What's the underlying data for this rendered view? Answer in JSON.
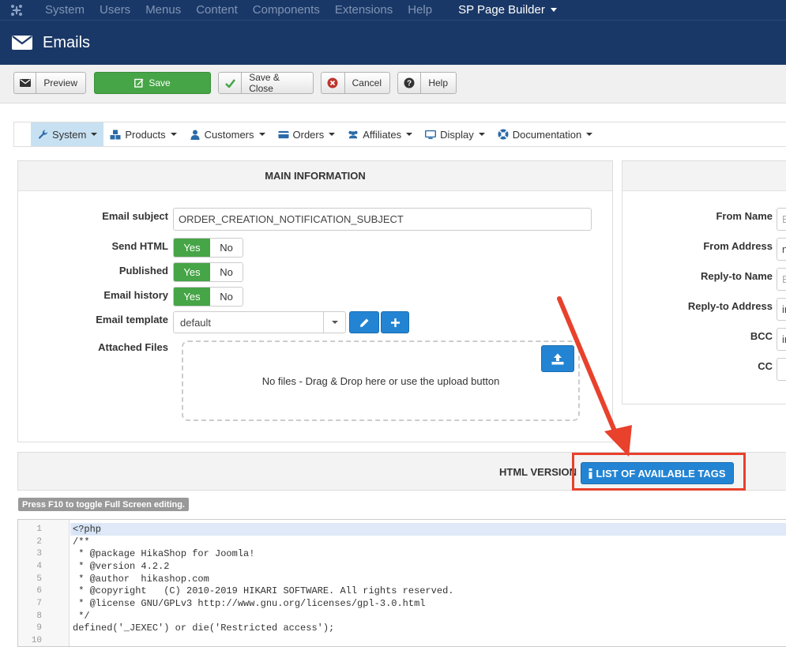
{
  "topnav": {
    "items": [
      "System",
      "Users",
      "Menus",
      "Content",
      "Components",
      "Extensions",
      "Help"
    ],
    "sp_label": "SP Page Builder"
  },
  "header": {
    "title": "Emails"
  },
  "toolbar": {
    "preview": "Preview",
    "save": "Save",
    "save_close": "Save & Close",
    "cancel": "Cancel",
    "help": "Help"
  },
  "menubar": {
    "items": [
      {
        "label": "System",
        "icon": "wrench-icon"
      },
      {
        "label": "Products",
        "icon": "cubes-icon"
      },
      {
        "label": "Customers",
        "icon": "user-icon"
      },
      {
        "label": "Orders",
        "icon": "credit-card-icon"
      },
      {
        "label": "Affiliates",
        "icon": "users-icon"
      },
      {
        "label": "Display",
        "icon": "monitor-icon"
      },
      {
        "label": "Documentation",
        "icon": "lifebuoy-icon"
      }
    ]
  },
  "main_info": {
    "title": "MAIN INFORMATION",
    "email_subject_label": "Email subject",
    "email_subject_value": "ORDER_CREATION_NOTIFICATION_SUBJECT",
    "send_html_label": "Send HTML",
    "published_label": "Published",
    "email_history_label": "Email history",
    "yes": "Yes",
    "no": "No",
    "template_label": "Email template",
    "template_value": "default",
    "attached_label": "Attached Files",
    "dropzone_text": "No files - Drag & Drop here or use the upload button"
  },
  "right_panel": {
    "from_name": "From Name",
    "from_address": "From Address",
    "replyto_name": "Reply-to Name",
    "replyto_address": "Reply-to Address",
    "bcc": "BCC",
    "cc": "CC",
    "from_name_val": "E",
    "from_address_val": "n",
    "replyto_name_val": "E",
    "replyto_address_val": "ir",
    "bcc_val": "ir",
    "cc_val": ""
  },
  "html_version": {
    "label": "HTML VERSION",
    "tags_button": "LIST OF AVAILABLE TAGS",
    "f10_hint": "Press F10 to toggle Full Screen editing."
  },
  "code": {
    "lines": [
      {
        "n": "1",
        "t": "<?php"
      },
      {
        "n": "2",
        "t": "/**"
      },
      {
        "n": "3",
        "t": " * @package HikaShop for Joomla!"
      },
      {
        "n": "4",
        "t": " * @version 4.2.2"
      },
      {
        "n": "5",
        "t": " * @author  hikashop.com"
      },
      {
        "n": "6",
        "t": " * @copyright   (C) 2010-2019 HIKARI SOFTWARE. All rights reserved."
      },
      {
        "n": "7",
        "t": " * @license GNU/GPLv3 http://www.gnu.org/licenses/gpl-3.0.html"
      },
      {
        "n": "8",
        "t": " */"
      },
      {
        "n": "9",
        "t": "defined('_JEXEC') or die('Restricted access');"
      },
      {
        "n": "10",
        "t": ""
      }
    ]
  },
  "colors": {
    "navbar": "#1a3867",
    "green": "#46a546",
    "blue": "#2384d3",
    "annotation_red": "#e8412c"
  }
}
